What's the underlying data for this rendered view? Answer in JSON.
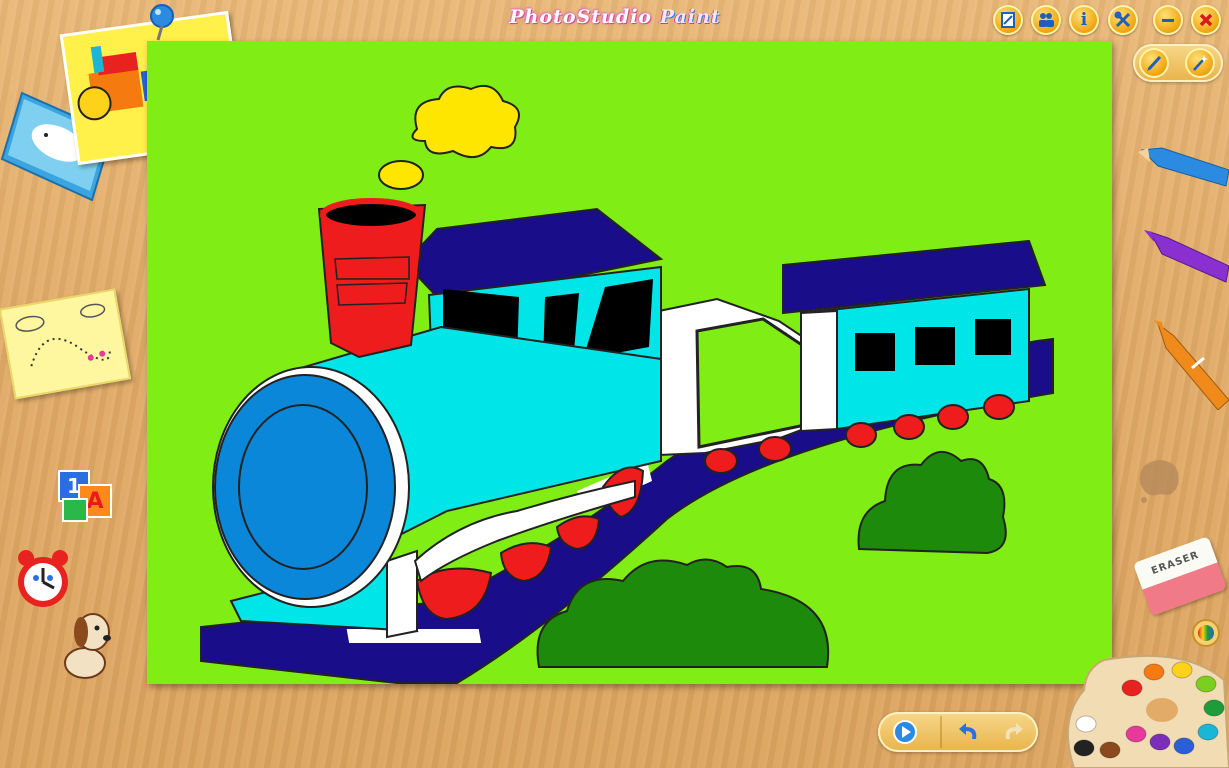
{
  "app": {
    "title_part1": "PhotoStudio",
    "title_part2": "Paint"
  },
  "toolbar": {
    "buttons": [
      {
        "name": "canvas-button",
        "icon": "frame-icon"
      },
      {
        "name": "gallery-button",
        "icon": "people-icon"
      },
      {
        "name": "info-button",
        "icon": "info-icon",
        "glyph": "i"
      },
      {
        "name": "tools-button",
        "icon": "wrench-icon"
      },
      {
        "name": "minimize-button",
        "icon": "minus-icon"
      },
      {
        "name": "close-button",
        "icon": "close-icon"
      }
    ],
    "secondary": [
      {
        "name": "brush-mode-button",
        "icon": "pencil-icon"
      },
      {
        "name": "magic-wand-button",
        "icon": "wand-icon"
      }
    ]
  },
  "tools": {
    "eraser_label": "ERASER",
    "abc_block": "1A"
  },
  "palette": {
    "colors": [
      "#e8231f",
      "#f57a10",
      "#ffd21a",
      "#7bcf1e",
      "#1e9c3a",
      "#19b6d8",
      "#2a5fd8",
      "#7b2fb8",
      "#e8389a",
      "#ffffff",
      "#222222",
      "#8a4a1e"
    ]
  },
  "bottom": {
    "buttons": [
      {
        "name": "play-button",
        "icon": "play-icon"
      },
      {
        "name": "undo-button",
        "icon": "undo-icon"
      },
      {
        "name": "redo-button",
        "icon": "redo-icon"
      }
    ]
  },
  "colors": {
    "canvas": "#80ee14",
    "boiler": "#00e5e8",
    "roof": "#1a0d8a",
    "chimney": "#ee1c1c",
    "wheels": "#ee1c1c",
    "cloud": "#ffe600",
    "bush": "#1e8a0c",
    "boiler_face": "#0a87d8"
  }
}
